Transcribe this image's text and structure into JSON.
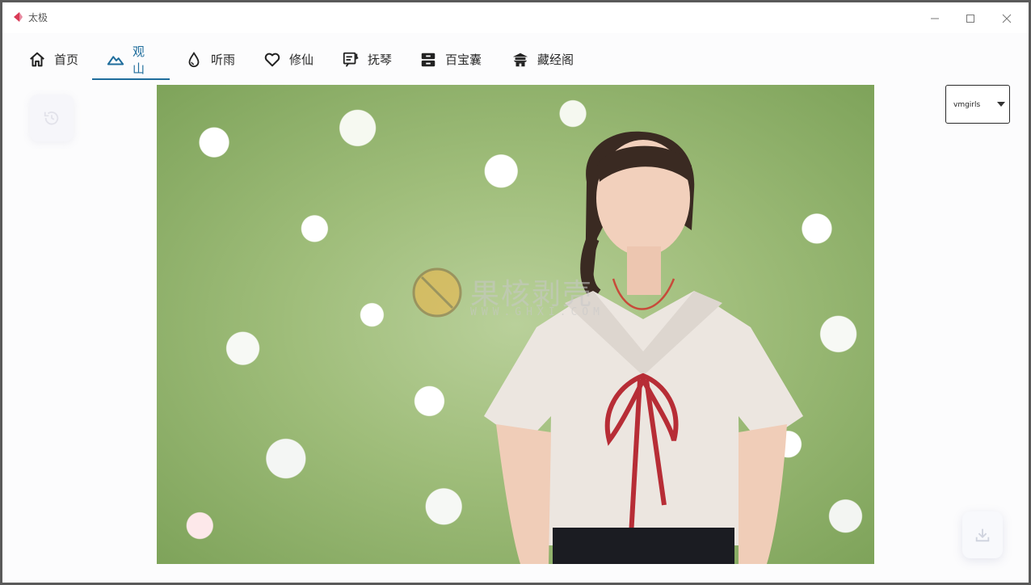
{
  "window": {
    "title": "太极",
    "controls": {
      "minimize_icon": "minimize-icon",
      "maximize_icon": "maximize-icon",
      "close_icon": "close-icon"
    }
  },
  "tabs": [
    {
      "label": "首页",
      "icon": "home-icon",
      "active": false
    },
    {
      "label": "观山",
      "icon": "mountain-icon",
      "active": true
    },
    {
      "label": "听雨",
      "icon": "water-drop-icon",
      "active": false
    },
    {
      "label": "修仙",
      "icon": "heart-icon",
      "active": false
    },
    {
      "label": "抚琴",
      "icon": "music-note-icon",
      "active": false
    },
    {
      "label": "百宝囊",
      "icon": "inbox-icon",
      "active": false
    },
    {
      "label": "藏经阁",
      "icon": "pagoda-icon",
      "active": false
    }
  ],
  "source_select": {
    "value": "vmgirls"
  },
  "watermark": {
    "text": "果核剥壳",
    "url": "WWW.GHXI.COM"
  },
  "colors": {
    "accent": "#1f6d9c",
    "border": "#5a5a5a"
  }
}
